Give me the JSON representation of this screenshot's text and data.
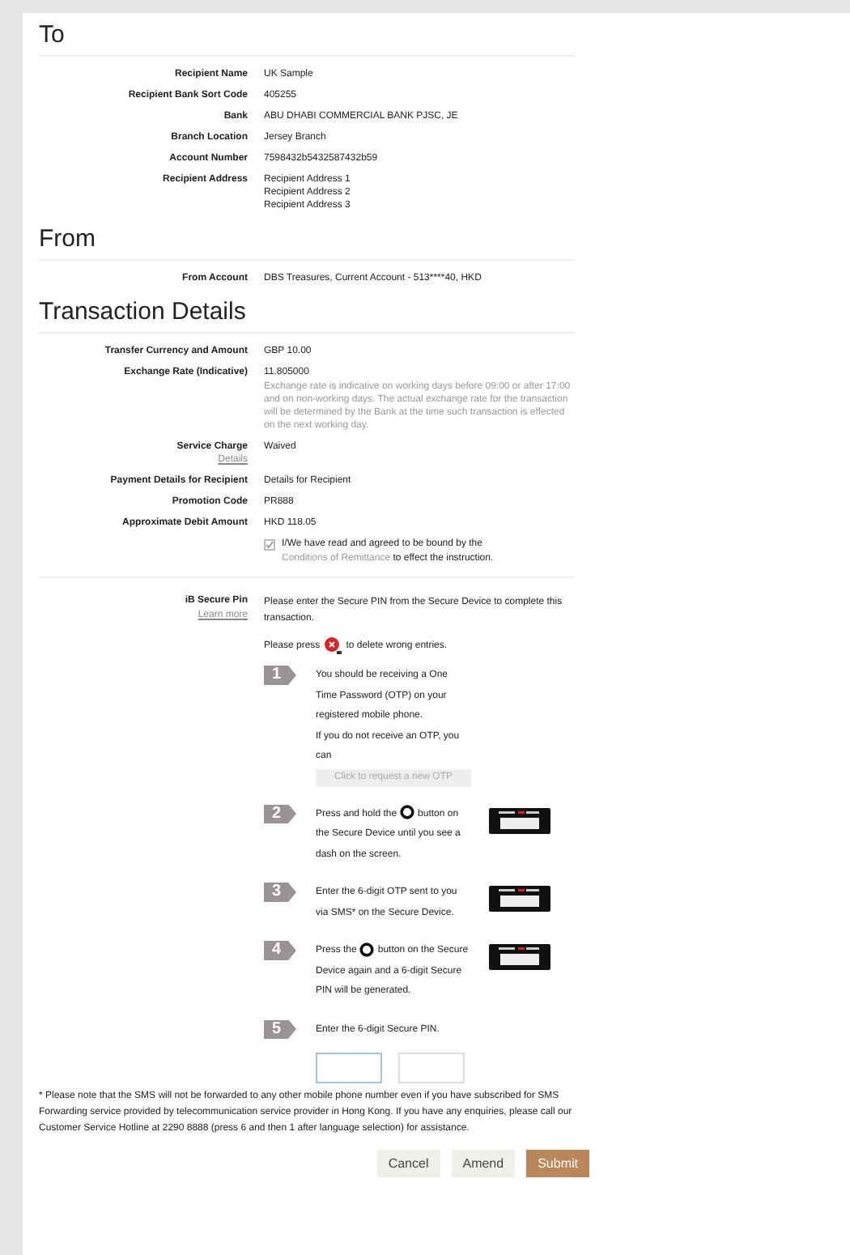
{
  "sections": [
    {
      "title": "To",
      "rows": [
        {
          "label": "Recipient Name",
          "values": [
            "UK Sample"
          ]
        },
        {
          "label": "Recipient Bank Sort Code",
          "values": [
            "405255"
          ]
        },
        {
          "label": "Bank",
          "values": [
            "ABU DHABI COMMERCIAL BANK PJSC, JE"
          ]
        },
        {
          "label": "Branch Location",
          "values": [
            "Jersey Branch"
          ]
        },
        {
          "label": "Account Number",
          "values": [
            "7598432b5432587432b59"
          ]
        },
        {
          "label": "Recipient Address",
          "values": [
            "Recipient Address 1",
            "Recipient Address 2",
            "Recipient Address 3"
          ]
        }
      ]
    },
    {
      "title": "From",
      "rows": [
        {
          "label": "From Account",
          "values": [
            "DBS Treasures, Current Account - 513****40, HKD"
          ]
        }
      ]
    },
    {
      "title": "Transaction Details",
      "rows": [
        {
          "label": "Transfer Currency and Amount",
          "values": [
            "GBP 10.00"
          ]
        },
        {
          "label": "Exchange Rate (Indicative)",
          "values": [
            "11.805000"
          ],
          "note": "Exchange rate is indicative on working days before 09:00 or after 17:00 and on non-working days. The actual exchange rate for the transaction will be determined by the Bank at the time such transaction is effected on the next working day."
        },
        {
          "label": "Service Charge",
          "link": "Details",
          "values": [
            "Waived"
          ]
        },
        {
          "label": "Payment Details for Recipient",
          "values": [
            "Details for Recipient"
          ]
        },
        {
          "label": "Promotion Code",
          "values": [
            "PR888"
          ]
        },
        {
          "label": "Approximate Debit Amount",
          "values": [
            "HKD 118.05"
          ]
        }
      ]
    }
  ],
  "agreement": {
    "checked": true,
    "text_before": "I/We have read and agreed to be bound by the",
    "link": "Conditions of Remittance",
    "text_after": "to effect the instruction."
  },
  "secure_pin": {
    "label": "iB Secure Pin",
    "link": "Learn more",
    "intro": "Please enter the Secure PIN from the Secure Device to complete this transaction.",
    "press_before": "Please press",
    "press_after": "to delete wrong entries.",
    "steps": [
      {
        "number": "1",
        "text": "You should be receiving a One Time Password (OTP) on your registered mobile phone.",
        "extra": "If you do not receive an OTP, you can",
        "button": {
          "label": "Click to request a new OTP",
          "disabled": true
        }
      },
      {
        "number": "2",
        "text_before": "Press and hold the",
        "text_after": "button on the Secure Device until you see a dash on the screen.",
        "device": true
      },
      {
        "number": "3",
        "text": "Enter the 6-digit OTP sent to you via SMS* on the Secure Device.",
        "device": true
      },
      {
        "number": "4",
        "text_before": "Press the",
        "text_after": "button on the Secure Device again and a 6-digit Secure PIN will be generated.",
        "device": true
      },
      {
        "number": "5",
        "text": "Enter the 6-digit Secure PIN."
      }
    ],
    "pin_fields": [
      {
        "focused": true
      },
      {
        "focused": false
      }
    ]
  },
  "footnote": "* Please note that the SMS will not be forwarded to any other mobile phone number even if you have subscribed for SMS Forwarding service provided by telecommunication service provider in Hong Kong. If you have any enquiries, please call our Customer Service Hotline at 2290 8888 (press 6 and then 1 after language selection) for assistance.",
  "buttons": [
    {
      "label": "Cancel",
      "kind": "secondary"
    },
    {
      "label": "Amend",
      "kind": "secondary"
    },
    {
      "label": "Submit",
      "kind": "primary"
    }
  ]
}
